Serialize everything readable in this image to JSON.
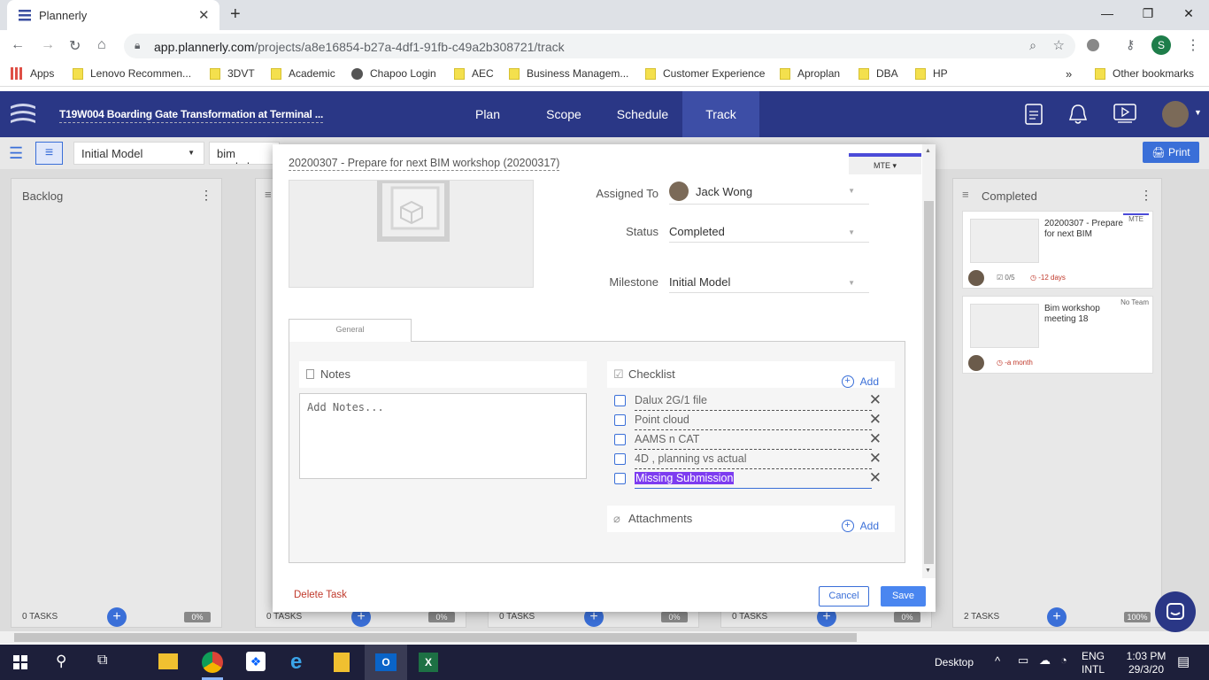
{
  "browser": {
    "tab_title": "Plannerly",
    "url_host": "app.plannerly.com",
    "url_path": "/projects/a8e16854-b27a-4df1-91fb-c49a2b308721/track",
    "profile_initial": "S",
    "bookmarks": [
      "Apps",
      "Lenovo Recommen...",
      "3DVT",
      "Academic",
      "Chapoo Login",
      "AEC",
      "Business Managem...",
      "Customer Experience",
      "Aproplan",
      "DBA",
      "HP"
    ],
    "other_bookmarks": "Other bookmarks",
    "more": "»"
  },
  "app": {
    "project_title": "T19W004 Boarding Gate Transformation at Terminal ...",
    "nav": [
      "Plan",
      "Scope",
      "Schedule",
      "Track"
    ],
    "active_nav": "Track"
  },
  "toolbar": {
    "milestone_filter": "Initial Model",
    "search_value": "bim worksh",
    "print_label": "Print"
  },
  "board": {
    "columns": [
      {
        "title": "Backlog",
        "tasks": "0 TASKS",
        "pct": "0%"
      },
      {
        "title": "",
        "tasks": "0 TASKS",
        "pct": "0%"
      },
      {
        "title": "",
        "tasks": "0 TASKS",
        "pct": "0%"
      },
      {
        "title": "",
        "tasks": "0 TASKS",
        "pct": "0%"
      },
      {
        "title": "Completed",
        "tasks": "2 TASKS",
        "pct": "100%"
      }
    ],
    "cards": [
      {
        "title": "20200307 - Prepare for next BIM",
        "tag": "MTE",
        "checklist": "0/5",
        "due": "-12 days"
      },
      {
        "title": "Bim workshop meeting 18",
        "tag": "No Team",
        "due": "-a month"
      }
    ]
  },
  "modal": {
    "title": "20200307 - Prepare for next BIM workshop (20200317)",
    "team_tag": "MTE ▾",
    "fields": {
      "assigned_label": "Assigned To",
      "assigned_value": "Jack Wong",
      "status_label": "Status",
      "status_value": "Completed",
      "milestone_label": "Milestone",
      "milestone_value": "Initial Model"
    },
    "tab_general": "General",
    "notes_label": "Notes",
    "notes_placeholder": "Add Notes...",
    "checklist_label": "Checklist",
    "add_label": "Add",
    "checklist": [
      "Dalux 2G/1 file",
      "Point cloud",
      "AAMS n CAT",
      "4D , planning vs actual",
      "Missing Submission"
    ],
    "attachments_label": "Attachments",
    "delete_label": "Delete Task",
    "cancel_label": "Cancel",
    "save_label": "Save"
  },
  "taskbar": {
    "desktop_label": "Desktop",
    "lang1": "ENG",
    "lang2": "INTL",
    "time": "1:03 PM",
    "date": "29/3/20"
  },
  "colors": {
    "header": "#2a3786",
    "accent": "#3a6fd8",
    "danger": "#c0392b"
  }
}
